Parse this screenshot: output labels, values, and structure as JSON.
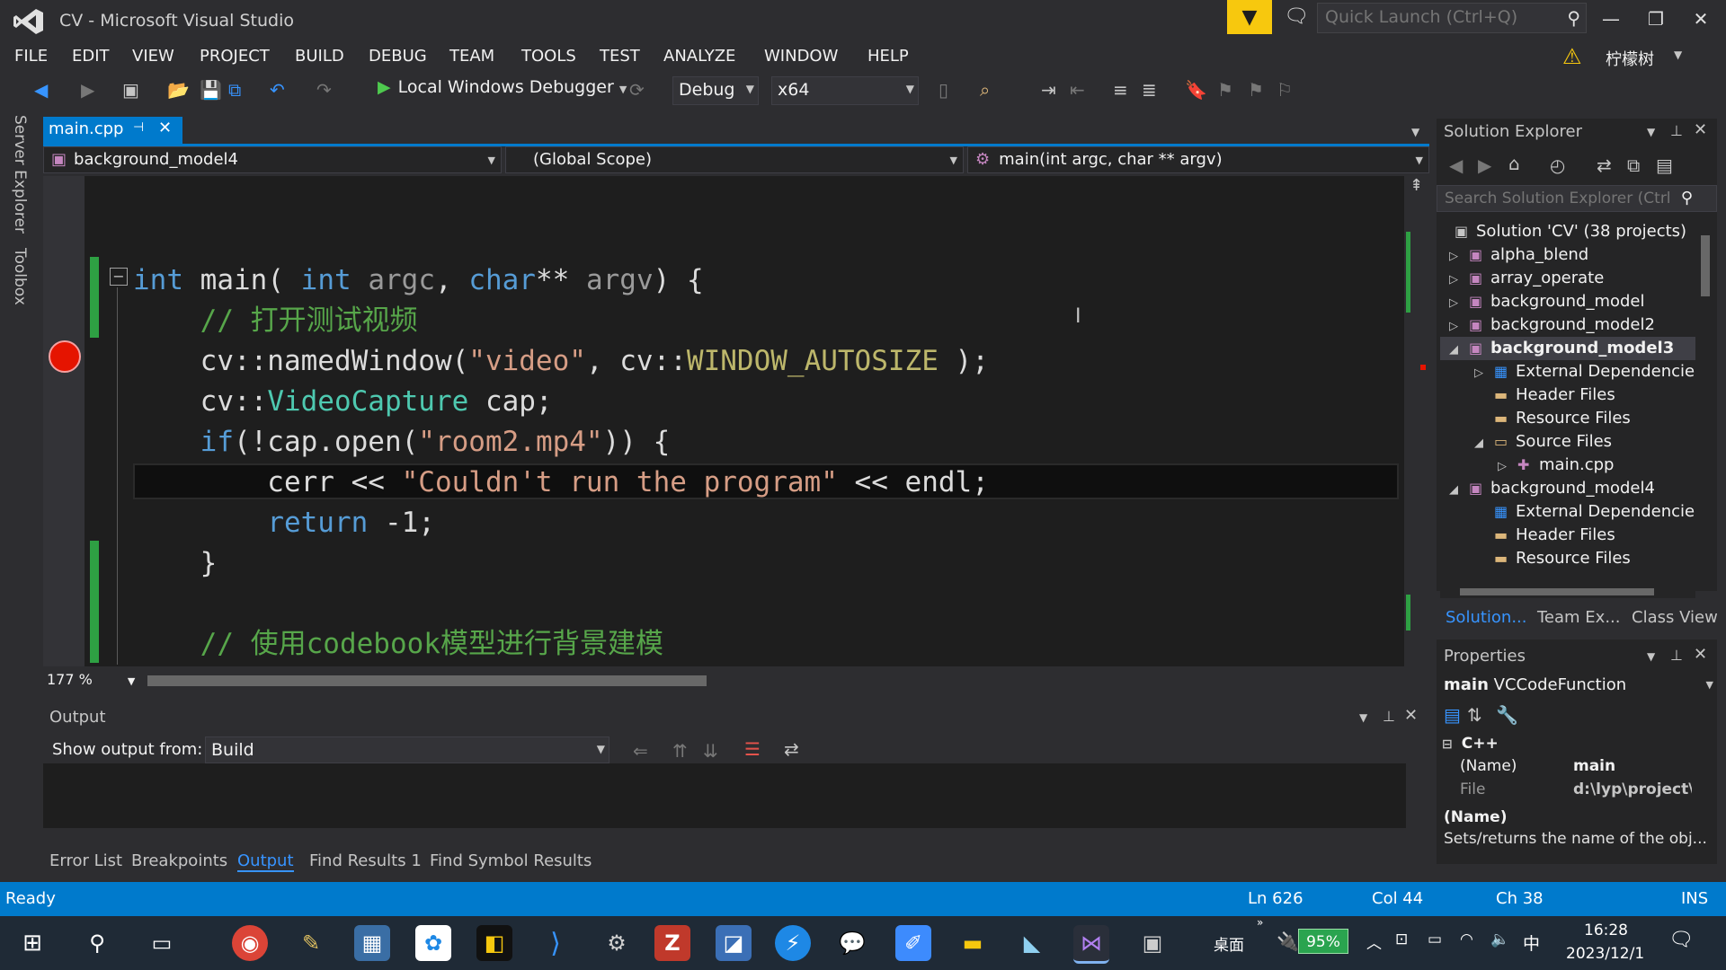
{
  "window": {
    "title": "CV - Microsoft Visual Studio",
    "quick_launch_placeholder": "Quick Launch (Ctrl+Q)",
    "user": "柠檬树"
  },
  "menu": [
    "FILE",
    "EDIT",
    "VIEW",
    "PROJECT",
    "BUILD",
    "DEBUG",
    "TEAM",
    "TOOLS",
    "TEST",
    "ANALYZE",
    "WINDOW",
    "HELP"
  ],
  "toolbar": {
    "debugger_label": "Local Windows Debugger",
    "config": "Debug",
    "platform": "x64"
  },
  "side_tabs": [
    "Server Explorer",
    "Toolbox"
  ],
  "editor": {
    "tab_label": "main.cpp",
    "nav_project": "background_model4",
    "nav_scope": "(Global Scope)",
    "nav_function": "main(int argc, char ** argv)",
    "zoom": "177 %"
  },
  "output": {
    "title": "Output",
    "show_from_label": "Show output from:",
    "show_from_value": "Build"
  },
  "bottom_tabs": [
    "Error List",
    "Breakpoints",
    "Output",
    "Find Results 1",
    "Find Symbol Results"
  ],
  "solution_explorer": {
    "title": "Solution Explorer",
    "search_placeholder": "Search Solution Explorer (Ctrl",
    "items": [
      {
        "label": "Solution 'CV' (38 projects)"
      },
      {
        "label": "alpha_blend"
      },
      {
        "label": "array_operate"
      },
      {
        "label": "background_model"
      },
      {
        "label": "background_model2"
      },
      {
        "label": "background_model3"
      },
      {
        "label": "External Dependencie"
      },
      {
        "label": "Header Files"
      },
      {
        "label": "Resource Files"
      },
      {
        "label": "Source Files"
      },
      {
        "label": "main.cpp"
      },
      {
        "label": "background_model4"
      },
      {
        "label": "External Dependencie"
      },
      {
        "label": "Header Files"
      },
      {
        "label": "Resource Files"
      }
    ],
    "tabs": [
      "Solution...",
      "Team Ex...",
      "Class View"
    ]
  },
  "properties": {
    "title": "Properties",
    "object_name": "main",
    "object_type": "VCCodeFunction",
    "category": "C++",
    "rows": [
      {
        "key": "(Name)",
        "value": "main"
      },
      {
        "key": "File",
        "value": "d:\\lyp\\project\\"
      }
    ],
    "desc_title": "(Name)",
    "desc_text": "Sets/returns the name of the obj..."
  },
  "status": {
    "ready": "Ready",
    "ln": "Ln 626",
    "col": "Col 44",
    "ch": "Ch 38",
    "mode": "INS"
  },
  "taskbar": {
    "desktop_label": "桌面",
    "battery": "95%",
    "ime": "中",
    "time": "16:28",
    "date": "2023/12/1"
  },
  "colors": {
    "accent": "#007acc",
    "keyword": "#569cd6",
    "comment": "#57a64a",
    "string": "#d69d85",
    "type": "#4ec9b0",
    "breakpoint": "#e51400"
  }
}
